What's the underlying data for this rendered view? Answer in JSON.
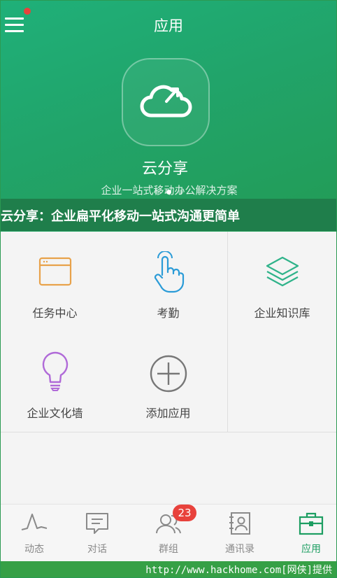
{
  "header": {
    "title": "应用"
  },
  "hero": {
    "app_name": "云分享",
    "app_desc": "企业一站式移动办公解决方案",
    "ticker_text": "云分享：企业扁平化移动一站式沟通更简单",
    "carousel_dots": 3,
    "active_dot": 1
  },
  "apps": [
    {
      "label": "任务中心",
      "icon": "task-center-icon",
      "color": "#e8a24a"
    },
    {
      "label": "考勤",
      "icon": "attendance-hand-icon",
      "color": "#2a9bd7"
    },
    {
      "label": "企业知识库",
      "icon": "knowledge-layers-icon",
      "color": "#2fb38a"
    },
    {
      "label": "企业文化墙",
      "icon": "culture-bulb-icon",
      "color": "#b06ad8"
    },
    {
      "label": "添加应用",
      "icon": "add-app-icon",
      "color": "#777777"
    }
  ],
  "tabs": [
    {
      "label": "动态",
      "icon": "activity-icon"
    },
    {
      "label": "对话",
      "icon": "chat-icon"
    },
    {
      "label": "群组",
      "icon": "group-icon",
      "badge": "23"
    },
    {
      "label": "通讯录",
      "icon": "contacts-icon"
    },
    {
      "label": "应用",
      "icon": "apps-briefcase-icon",
      "active": true
    }
  ],
  "footer": {
    "text": "http://www.hackhome.com[网侠]提供"
  },
  "colors": {
    "brand_green": "#1fa868",
    "badge_red": "#e8423c",
    "tab_active": "#1d9e62"
  }
}
